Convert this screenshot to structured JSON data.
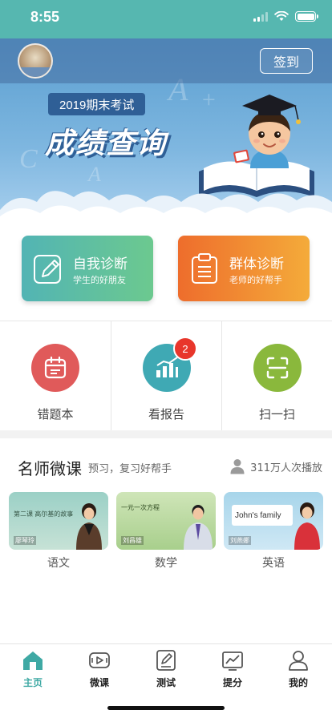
{
  "status_bar": {
    "time": "8:55"
  },
  "banner": {
    "checkin_label": "签到",
    "exam_tag": "2019期末考试",
    "title": "成绩查询"
  },
  "diagnosis": {
    "self": {
      "title": "自我诊断",
      "subtitle": "学生的好朋友"
    },
    "group": {
      "title": "群体诊断",
      "subtitle": "老师的好帮手"
    }
  },
  "tools": [
    {
      "label": "错题本",
      "color": "#e05a5a",
      "icon": "calendar-icon"
    },
    {
      "label": "看报告",
      "color": "#3fa9b4",
      "icon": "bar-chart-icon",
      "badge": "2"
    },
    {
      "label": "扫一扫",
      "color": "#8ab83c",
      "icon": "scan-icon"
    }
  ],
  "courses": {
    "title": "名师微课",
    "subtitle": "预习，复习好帮手",
    "views": "311万人次播放",
    "videos": [
      {
        "subject": "语文",
        "board_text": "第二课  高尔基的故事",
        "teacher": "廖琴玲"
      },
      {
        "subject": "数学",
        "board_text": "一元一次方程",
        "teacher": "刘昌雄"
      },
      {
        "subject": "英语",
        "board_title": "John's family",
        "teacher": "刘燕娜"
      }
    ]
  },
  "tabbar": [
    {
      "label": "主页",
      "icon": "home-icon",
      "active": true
    },
    {
      "label": "微课",
      "icon": "video-icon",
      "active": false
    },
    {
      "label": "测试",
      "icon": "test-icon",
      "active": false
    },
    {
      "label": "提分",
      "icon": "trend-icon",
      "active": false
    },
    {
      "label": "我的",
      "icon": "profile-icon",
      "active": false
    }
  ],
  "colors": {
    "status_bar": "#56b7b0",
    "accent": "#3fa9a4",
    "badge": "#e8362b",
    "diag_self": "#52b4b4",
    "diag_group": "#ee6d2c"
  }
}
